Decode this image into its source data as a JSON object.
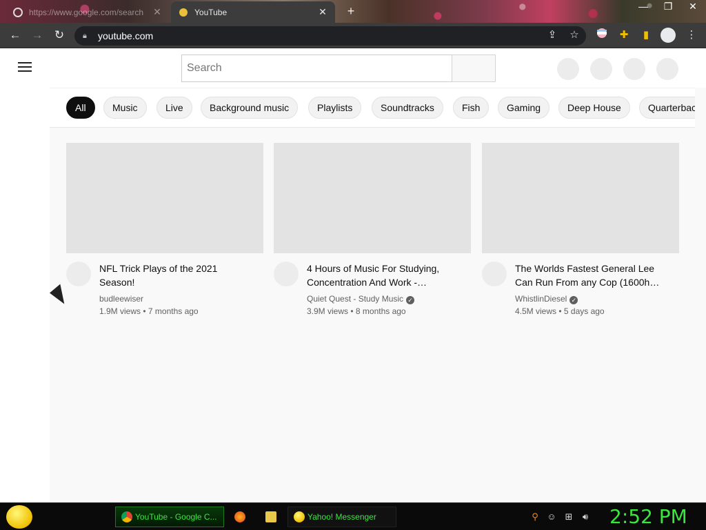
{
  "browser": {
    "tabs": [
      {
        "title": "https://www.google.com/search",
        "state": "inactive"
      },
      {
        "title": "YouTube",
        "state": "active"
      }
    ],
    "new_tab_glyph": "+",
    "close_glyph": "✕",
    "window_buttons": [
      "—",
      "❐",
      "✕"
    ],
    "url": "youtube.com"
  },
  "youtube": {
    "search_placeholder": "Search",
    "chips": [
      "All",
      "Music",
      "Live",
      "Background music",
      "Playlists",
      "Soundtracks",
      "Fish",
      "Gaming",
      "Deep House",
      "Quarterback"
    ],
    "videos": [
      {
        "title": "NFL Trick Plays of the 2021 Season!",
        "channel": "budleewiser",
        "verified": false,
        "meta": "1.9M views • 7 months ago"
      },
      {
        "title": "4 Hours of Music For Studying, Concentration And Work -…",
        "channel": "Quiet Quest - Study Music",
        "verified": true,
        "meta": "3.9M views • 8 months ago"
      },
      {
        "title": "The Worlds Fastest General Lee Can Run From any Cop (1600h…",
        "channel": "WhistlinDiesel",
        "verified": true,
        "meta": "4.5M views • 5 days ago"
      }
    ]
  },
  "taskbar": {
    "items": [
      {
        "label": "YouTube - Google C...",
        "active": true
      },
      {
        "label": "Yahoo! Messenger",
        "active": false
      }
    ],
    "clock": "2:52 PM"
  },
  "colors": {
    "accent_green": "#39e83f",
    "chip_selected": "#0f0f0f"
  }
}
